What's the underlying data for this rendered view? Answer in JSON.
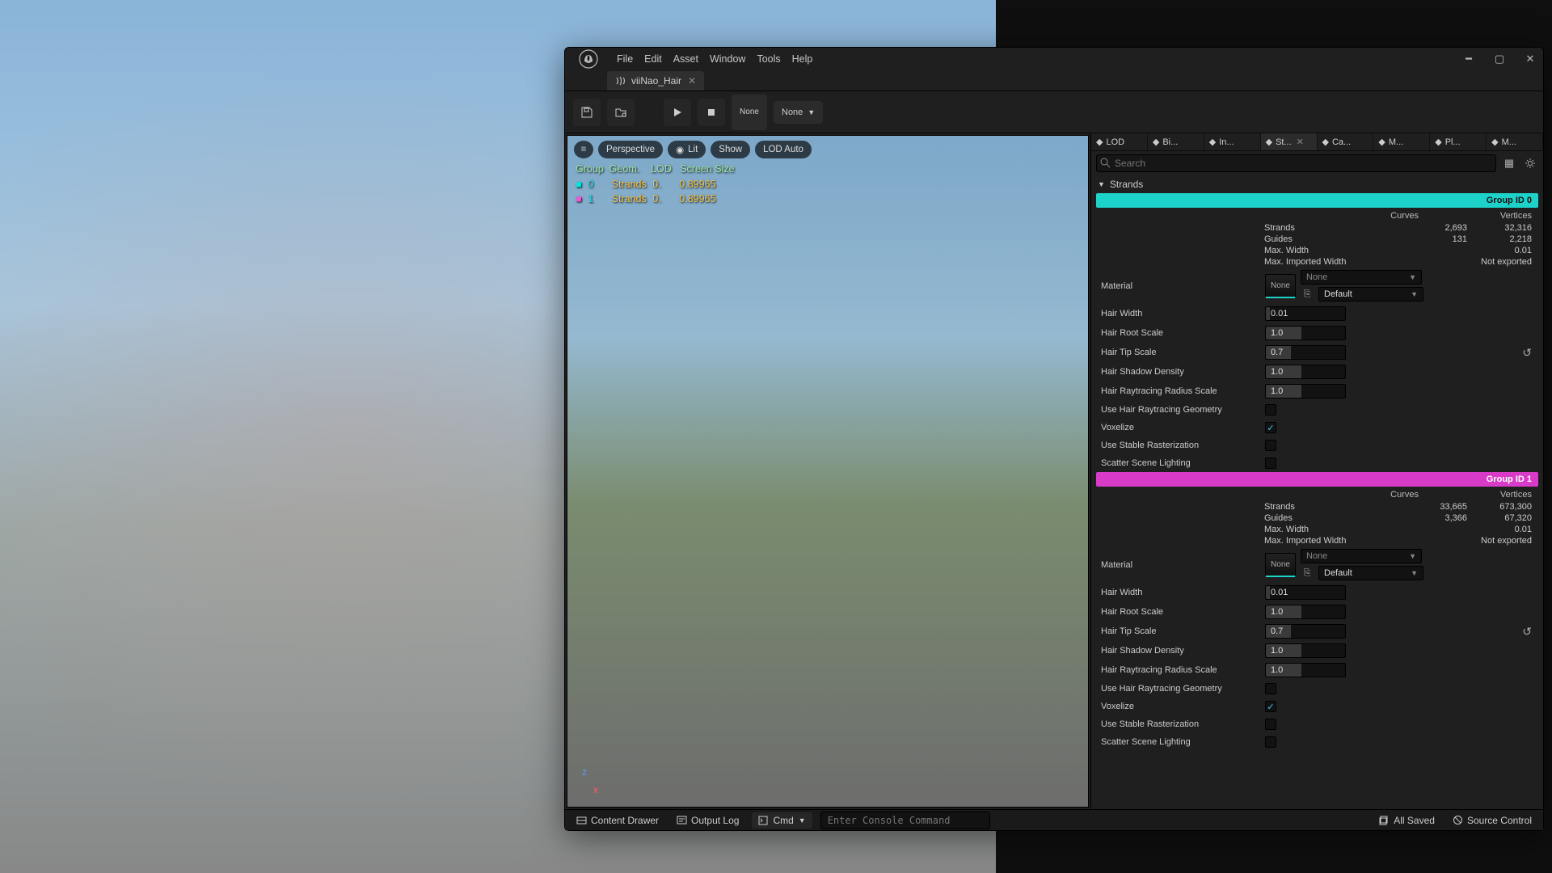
{
  "menus": [
    "File",
    "Edit",
    "Asset",
    "Window",
    "Tools",
    "Help"
  ],
  "tab": {
    "label": "viiNao_Hair"
  },
  "toolbar": {
    "none_label": "None",
    "simulate_label": "None"
  },
  "viewport_pills": {
    "perspective": "Perspective",
    "lit": "Lit",
    "show": "Show",
    "lod": "LOD Auto"
  },
  "viewport_overlay": {
    "header": "Group  Geom.    LOD   Screen Size",
    "rows": [
      {
        "marker_color": "#00E8DC",
        "idx": "0",
        "geom": "Strands",
        "lod": "0.",
        "ss": "0.89965"
      },
      {
        "marker_color": "#E85BD4",
        "idx": "1",
        "geom": "Strands",
        "lod": "0.",
        "ss": "0.89965"
      }
    ]
  },
  "right_tabs": [
    {
      "label": "LOD",
      "icon": "layers"
    },
    {
      "label": "Bi...",
      "icon": "dot"
    },
    {
      "label": "In...",
      "icon": "interp"
    },
    {
      "label": "St...",
      "icon": "strands",
      "active": true,
      "closable": true
    },
    {
      "label": "Ca...",
      "icon": "cards"
    },
    {
      "label": "M...",
      "icon": "mesh"
    },
    {
      "label": "Pl...",
      "icon": "play"
    },
    {
      "label": "M...",
      "icon": "mesh2"
    }
  ],
  "search": {
    "placeholder": "Search"
  },
  "section_label": "Strands",
  "columns": {
    "a": "Curves",
    "b": "Vertices"
  },
  "groups": [
    {
      "id_label": "Group ID 0",
      "bar_class": "teal",
      "stats": [
        {
          "label": "Strands",
          "a": "2,693",
          "b": "32,316"
        },
        {
          "label": "Guides",
          "a": "131",
          "b": "2,218"
        },
        {
          "label": "Max. Width",
          "b": "0.01"
        },
        {
          "label": "Max. Imported Width",
          "b": "Not exported"
        }
      ],
      "material": {
        "label": "Material",
        "thumb": "None",
        "asset": "None",
        "slot": "Default"
      },
      "props": [
        {
          "label": "Hair Width",
          "type": "num",
          "value": "0.01",
          "fill": 5
        },
        {
          "label": "Hair Root Scale",
          "type": "num",
          "value": "1.0",
          "fill": 45
        },
        {
          "label": "Hair Tip Scale",
          "type": "num",
          "value": "0.7",
          "fill": 32,
          "reset": true
        },
        {
          "label": "Hair Shadow Density",
          "type": "num",
          "value": "1.0",
          "fill": 45
        },
        {
          "label": "Hair Raytracing Radius Scale",
          "type": "num",
          "value": "1.0",
          "fill": 45
        },
        {
          "label": "Use Hair Raytracing Geometry",
          "type": "check",
          "checked": false
        },
        {
          "label": "Voxelize",
          "type": "check",
          "checked": true
        },
        {
          "label": "Use Stable Rasterization",
          "type": "check",
          "checked": false
        },
        {
          "label": "Scatter Scene Lighting",
          "type": "check",
          "checked": false
        }
      ]
    },
    {
      "id_label": "Group ID 1",
      "bar_class": "magenta",
      "stats": [
        {
          "label": "Strands",
          "a": "33,665",
          "b": "673,300"
        },
        {
          "label": "Guides",
          "a": "3,366",
          "b": "67,320"
        },
        {
          "label": "Max. Width",
          "b": "0.01"
        },
        {
          "label": "Max. Imported Width",
          "b": "Not exported"
        }
      ],
      "material": {
        "label": "Material",
        "thumb": "None",
        "asset": "None",
        "slot": "Default"
      },
      "props": [
        {
          "label": "Hair Width",
          "type": "num",
          "value": "0.01",
          "fill": 5
        },
        {
          "label": "Hair Root Scale",
          "type": "num",
          "value": "1.0",
          "fill": 45
        },
        {
          "label": "Hair Tip Scale",
          "type": "num",
          "value": "0.7",
          "fill": 32,
          "reset": true
        },
        {
          "label": "Hair Shadow Density",
          "type": "num",
          "value": "1.0",
          "fill": 45
        },
        {
          "label": "Hair Raytracing Radius Scale",
          "type": "num",
          "value": "1.0",
          "fill": 45
        },
        {
          "label": "Use Hair Raytracing Geometry",
          "type": "check",
          "checked": false
        },
        {
          "label": "Voxelize",
          "type": "check",
          "checked": true
        },
        {
          "label": "Use Stable Rasterization",
          "type": "check",
          "checked": false
        },
        {
          "label": "Scatter Scene Lighting",
          "type": "check",
          "checked": false
        }
      ]
    }
  ],
  "status": {
    "content_drawer": "Content Drawer",
    "output_log": "Output Log",
    "cmd_label": "Cmd",
    "cmd_placeholder": "Enter Console Command",
    "all_saved": "All Saved",
    "source_control": "Source Control"
  }
}
